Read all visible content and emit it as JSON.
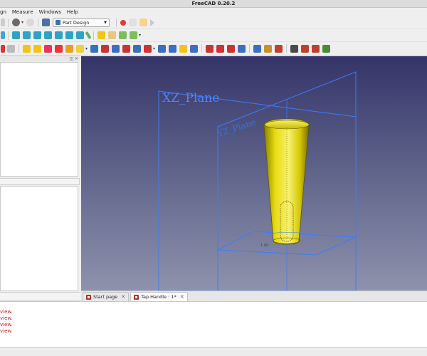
{
  "window": {
    "title": "FreeCAD 0.20.2"
  },
  "menu": {
    "items": [
      "gn",
      "Measure",
      "Windows",
      "Help"
    ]
  },
  "toolbar": {
    "workbench": "Part Design",
    "row1_icons": [
      "new-file-icon",
      "undo-icon",
      "refresh-icon",
      "workbench-icon",
      "record-macro-icon",
      "stop-macro-icon",
      "edit-macro-icon",
      "run-macro-icon"
    ],
    "row2_icons": [
      "view-isometric-icon",
      "view-front-icon",
      "view-top-icon",
      "view-right-icon",
      "view-rear-icon",
      "view-bottom-icon",
      "view-left-icon",
      "measure-icon",
      "create-body-icon",
      "create-part-icon",
      "link-icon",
      "link-actions-icon"
    ],
    "row3_icons": [
      "sketch-icon",
      "validate-sketch-icon",
      "map-sketch-icon",
      "point-icon",
      "line-icon",
      "plane-icon",
      "lcs-icon",
      "shapebinder-icon",
      "subshapebinder-icon",
      "clone-icon",
      "additive-primitive-icon",
      "pad-icon",
      "revolution-icon",
      "loft-icon",
      "pipe-icon",
      "helix-icon",
      "pocket-icon",
      "hole-icon",
      "groove-icon",
      "subtractive-loft-icon",
      "subtractive-pipe-icon",
      "subtractive-helix-icon",
      "subtractive-primitive-icon",
      "fillet-icon",
      "chamfer-icon",
      "draft-icon",
      "thickness-icon",
      "boolean-icon",
      "mirrored-icon",
      "linear-pattern-icon",
      "polar-pattern-icon",
      "multitransform-icon"
    ]
  },
  "viewport": {
    "plane_label_front": "XZ_Plane",
    "plane_label_back": "YZ_Plane",
    "dimension_label": "1.00",
    "colors": {
      "plane": "#3a7cff",
      "part": "#f0e100"
    }
  },
  "doc_tabs": [
    {
      "label": "Start page",
      "close": "✕"
    },
    {
      "label": "Tap Handle : 1*",
      "close": "✕"
    }
  ],
  "report": {
    "lines": [
      "view.",
      "view.",
      "view.",
      "view."
    ]
  }
}
